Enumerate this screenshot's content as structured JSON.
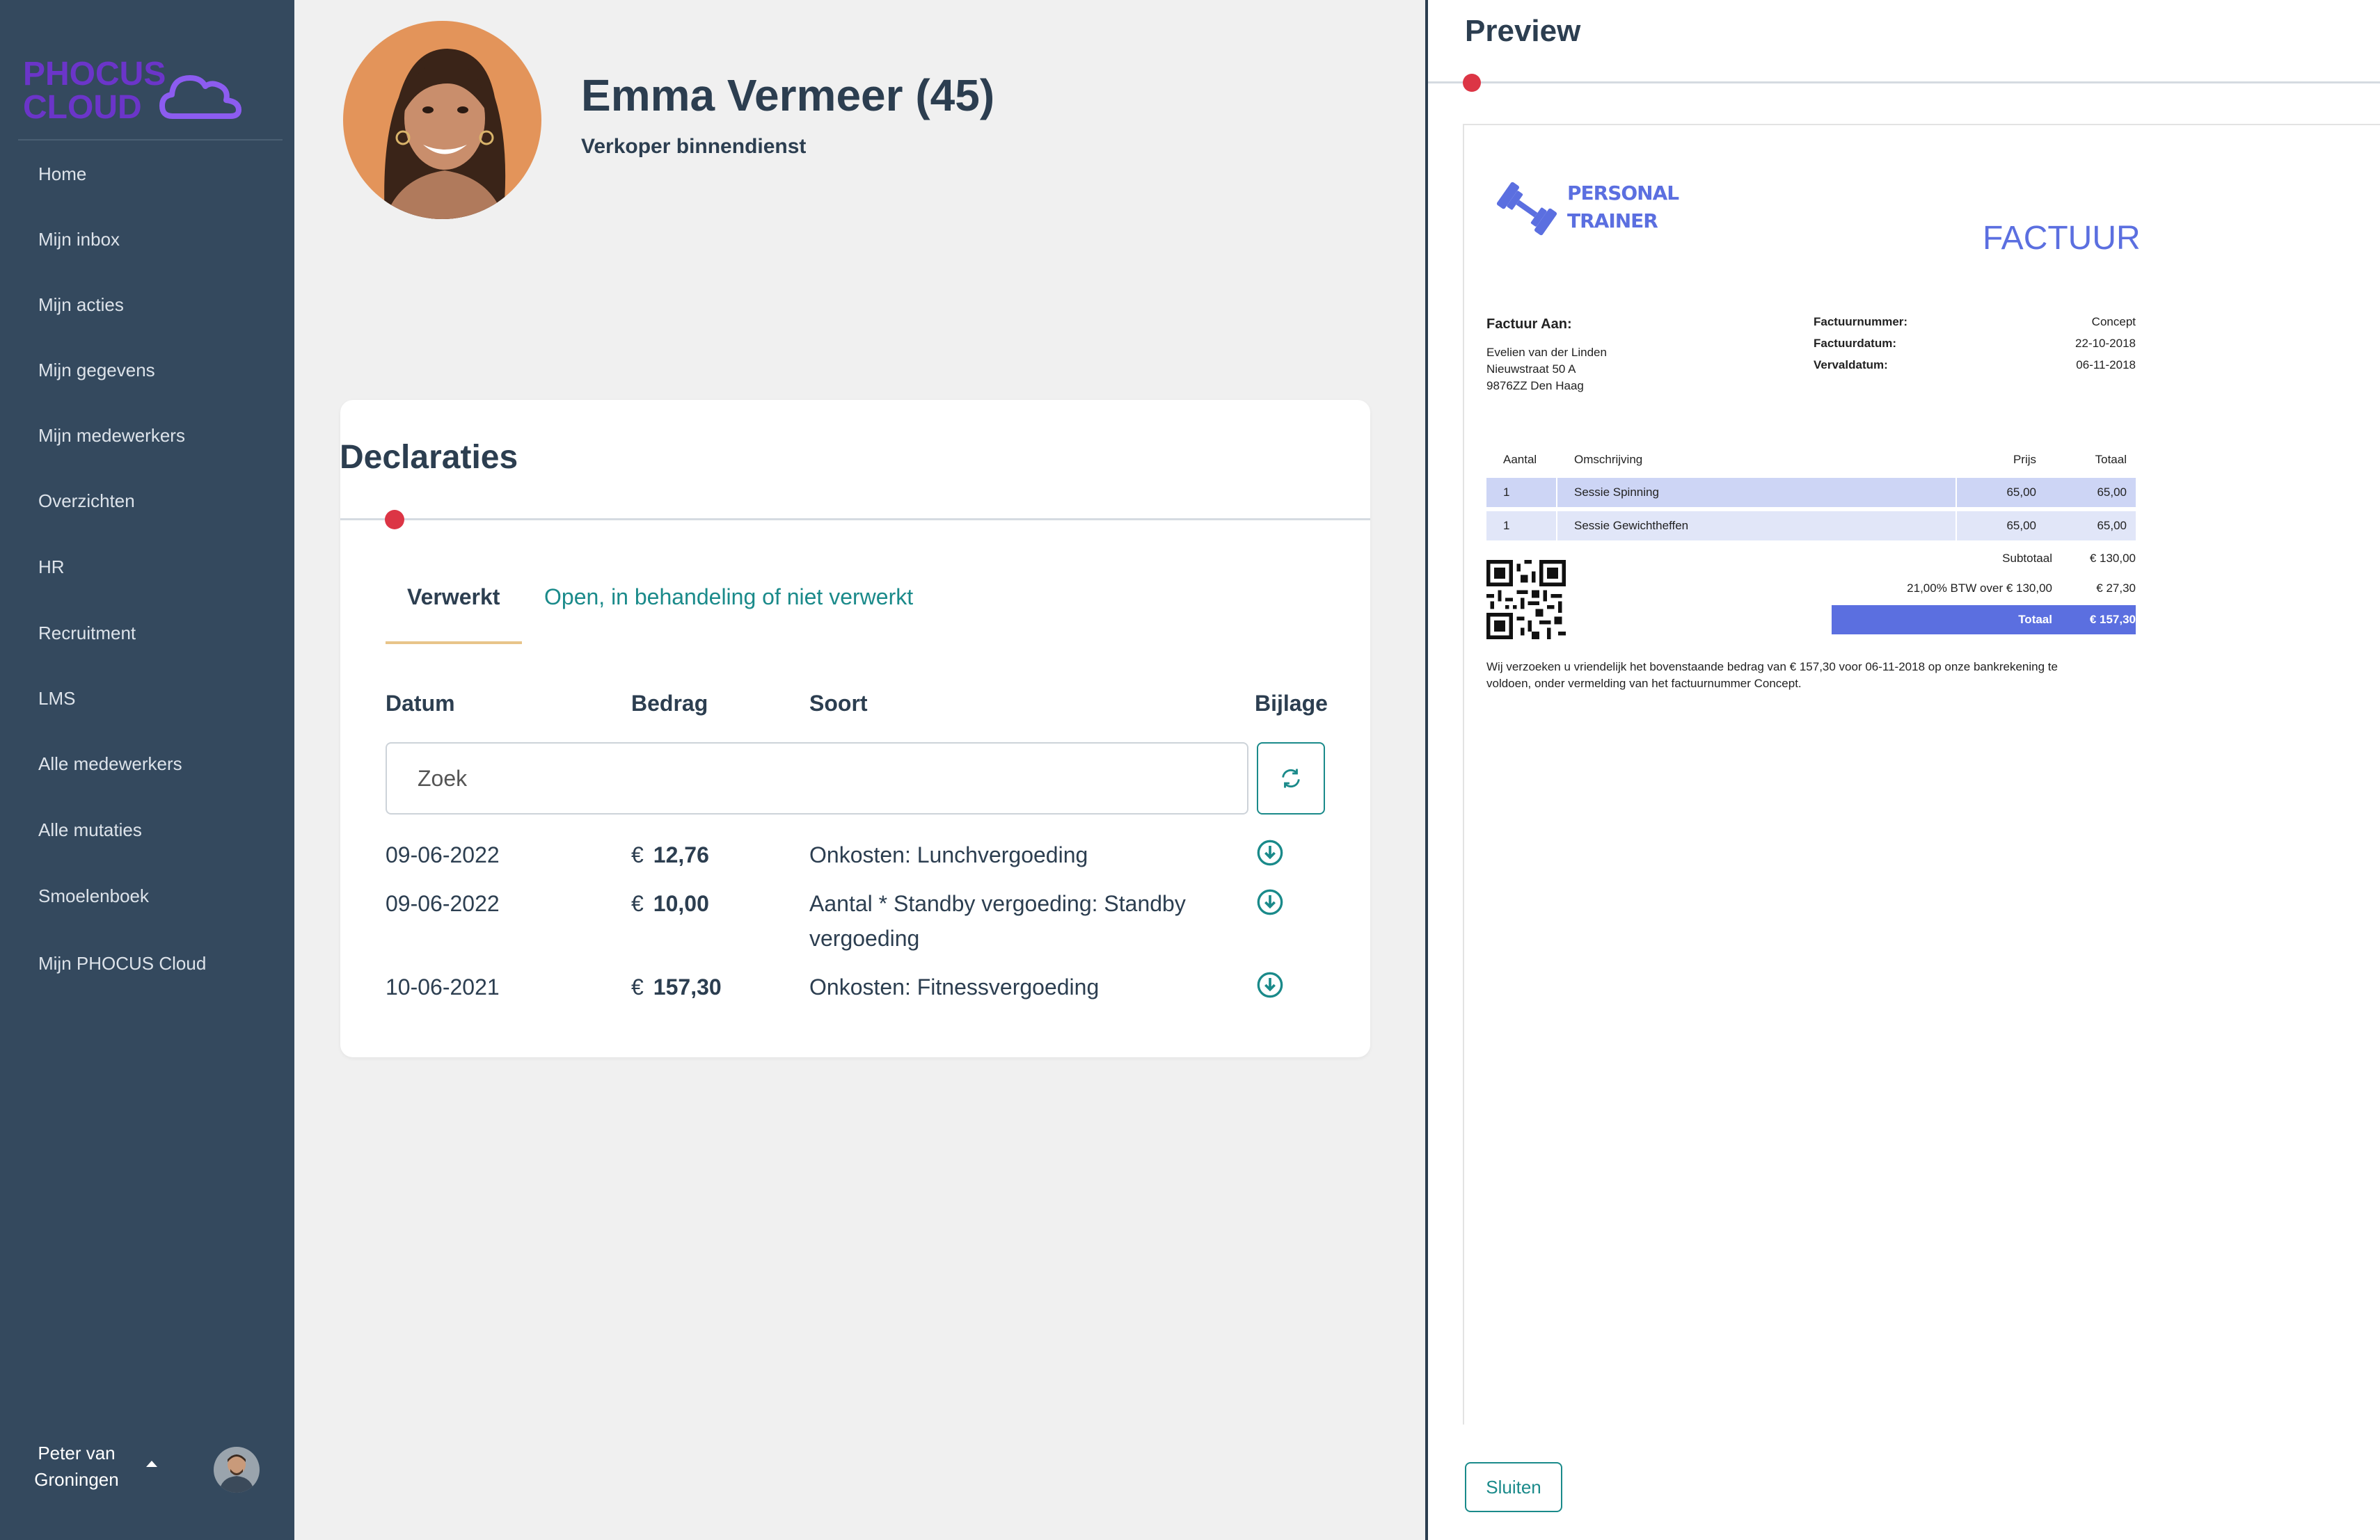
{
  "app": {
    "logo_text_line1": "PHOCUS",
    "logo_text_line2": "CLOUD",
    "brand_color": "#6b35c9"
  },
  "sidebar": {
    "items": [
      {
        "label": "Home"
      },
      {
        "label": "Mijn inbox"
      },
      {
        "label": "Mijn acties"
      },
      {
        "label": "Mijn gegevens"
      },
      {
        "label": "Mijn medewerkers"
      },
      {
        "label": "Overzichten"
      },
      {
        "label": "HR"
      },
      {
        "label": "Recruitment"
      },
      {
        "label": "LMS"
      },
      {
        "label": "Alle medewerkers"
      },
      {
        "label": "Alle mutaties"
      },
      {
        "label": "Smoelenboek"
      },
      {
        "label": "Mijn PHOCUS Cloud"
      }
    ],
    "user": {
      "name_line1": "Peter van",
      "name_line2": "Groningen"
    }
  },
  "profile": {
    "name": "Emma Vermeer (45)",
    "role": "Verkoper binnendienst"
  },
  "declaraties": {
    "title": "Declaraties",
    "tabs": [
      {
        "label": "Verwerkt",
        "active": true
      },
      {
        "label": "Open, in behandeling of niet verwerkt",
        "active": false
      }
    ],
    "columns": {
      "date": "Datum",
      "amount": "Bedrag",
      "type": "Soort",
      "attachment": "Bijlage"
    },
    "search_placeholder": "Zoek",
    "currency": "€",
    "rows": [
      {
        "date": "09-06-2022",
        "amount": "12,76",
        "type": "Onkosten: Lunchvergoeding"
      },
      {
        "date": "09-06-2022",
        "amount": "10,00",
        "type": "Aantal * Standby vergoeding: Standby vergoeding"
      },
      {
        "date": "10-06-2021",
        "amount": "157,30",
        "type": "Onkosten: Fitnessvergoeding"
      }
    ]
  },
  "preview": {
    "title": "Preview",
    "close_label": "Sluiten",
    "invoice": {
      "logo_line1": "PERSONAL",
      "logo_line2": "TRAINER",
      "heading": "FACTUUR",
      "to_label": "Factuur Aan:",
      "to_name": "Evelien van der Linden",
      "to_street": "Nieuwstraat 50 A",
      "to_city": "9876ZZ Den Haag",
      "meta": [
        {
          "label": "Factuurnummer:",
          "value": "Concept"
        },
        {
          "label": "Factuurdatum:",
          "value": "22-10-2018"
        },
        {
          "label": "Vervaldatum:",
          "value": "06-11-2018"
        }
      ],
      "table_headers": {
        "qty": "Aantal",
        "desc": "Omschrijving",
        "price": "Prijs",
        "total": "Totaal"
      },
      "lines": [
        {
          "qty": "1",
          "desc": "Sessie Spinning",
          "price": "65,00",
          "total": "65,00"
        },
        {
          "qty": "1",
          "desc": "Sessie Gewichtheffen",
          "price": "65,00",
          "total": "65,00"
        }
      ],
      "subtotal_label": "Subtotaal",
      "subtotal_value": "€ 130,00",
      "vat_label": "21,00% BTW over € 130,00",
      "vat_value": "€ 27,30",
      "total_label": "Totaal",
      "total_value": "€ 157,30",
      "note_line1": "Wij verzoeken u vriendelijk het bovenstaande bedrag van € 157,30 voor 06-11-2018 op onze bankrekening te",
      "note_line2": "voldoen, onder vermelding van het factuurnummer Concept.",
      "accent_color": "#5b6fe0"
    }
  }
}
